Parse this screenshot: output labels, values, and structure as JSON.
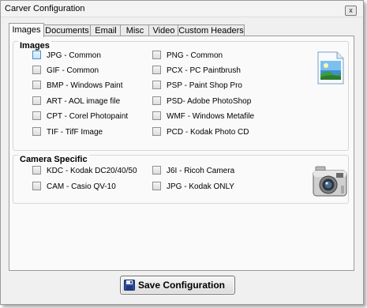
{
  "window": {
    "title": "Carver Configuration",
    "close_glyph": "x"
  },
  "tabs": [
    {
      "label": "Images",
      "active": true
    },
    {
      "label": "Documents"
    },
    {
      "label": "Email"
    },
    {
      "label": "Misc"
    },
    {
      "label": "Video"
    },
    {
      "label": "Custom Headers"
    }
  ],
  "images_group": {
    "title": "Images",
    "icon": "image-file-icon",
    "left": [
      {
        "label": "JPG - Common",
        "checked": false
      },
      {
        "label": "GIF - Common",
        "checked": false
      },
      {
        "label": "BMP - Windows Paint",
        "checked": false
      },
      {
        "label": "ART - AOL image file",
        "checked": false
      },
      {
        "label": "CPT - Corel Photopaint",
        "checked": false
      },
      {
        "label": "TIF - TifF Image",
        "checked": false
      }
    ],
    "right": [
      {
        "label": "PNG - Common",
        "checked": false
      },
      {
        "label": "PCX - PC Paintbrush",
        "checked": false
      },
      {
        "label": "PSP - Paint Shop Pro",
        "checked": false
      },
      {
        "label": "PSD- Adobe PhotoShop",
        "checked": false
      },
      {
        "label": "WMF - Windows Metafile",
        "checked": false
      },
      {
        "label": "PCD - Kodak Photo CD",
        "checked": false
      }
    ]
  },
  "camera_group": {
    "title": "Camera Specific",
    "icon": "camera-icon",
    "left": [
      {
        "label": "KDC - Kodak DC20/40/50",
        "checked": false
      },
      {
        "label": "CAM -  Casio  QV-10",
        "checked": false
      }
    ],
    "right": [
      {
        "label": "J6I   - Ricoh Camera",
        "checked": false
      },
      {
        "label": "JPG - Kodak ONLY",
        "checked": false
      }
    ]
  },
  "save_button": {
    "label": "Save Configuration",
    "icon": "floppy-disk-icon"
  }
}
